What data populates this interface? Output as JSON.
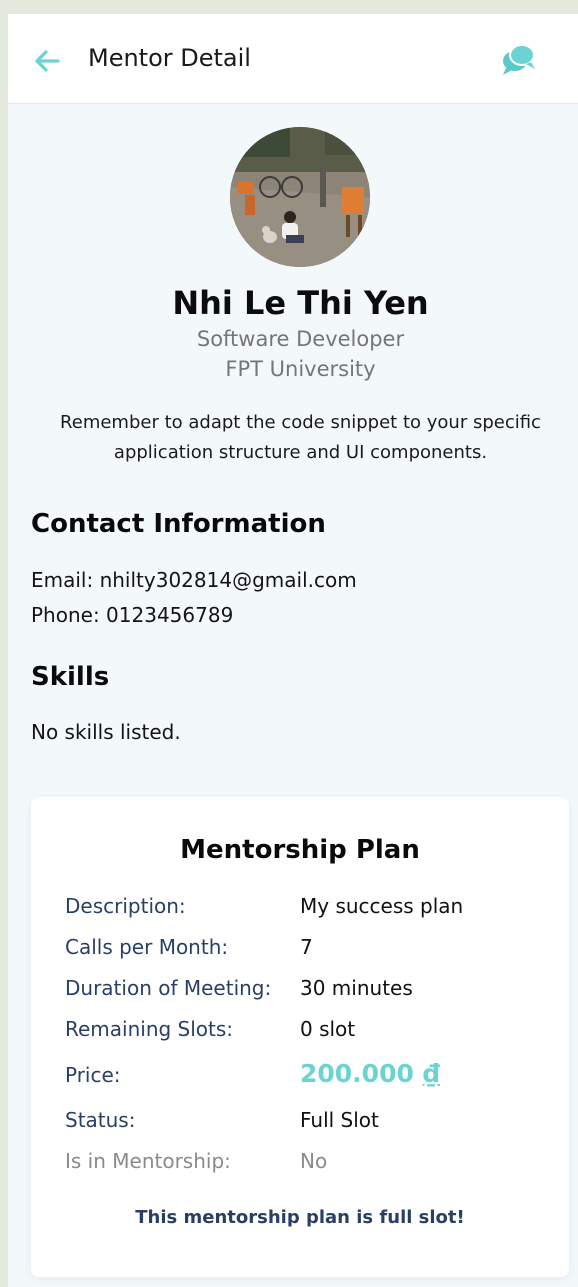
{
  "header": {
    "title": "Mentor Detail",
    "back_icon": "arrow-left-icon",
    "chat_icon": "chat-bubbles-icon",
    "accent_color": "#6cd3d3"
  },
  "mentor": {
    "name": "Nhi Le Thi Yen",
    "job_title": "Software Developer",
    "organization": "FPT University",
    "bio": "Remember to adapt the code snippet to your specific application structure and UI components."
  },
  "contact": {
    "section_title": "Contact Information",
    "email_line": "Email: nhilty302814@gmail.com",
    "phone_line": "Phone: 0123456789"
  },
  "skills": {
    "section_title": "Skills",
    "empty_text": "No skills listed."
  },
  "plan": {
    "title": "Mentorship Plan",
    "rows": [
      {
        "label": "Description:",
        "value": "My success plan"
      },
      {
        "label": "Calls per Month:",
        "value": "7"
      },
      {
        "label": "Duration of Meeting:",
        "value": "30 minutes"
      },
      {
        "label": "Remaining Slots:",
        "value": "0 slot"
      },
      {
        "label": "Price:",
        "value": "200.000",
        "currency": "₫"
      },
      {
        "label": "Status:",
        "value": "Full Slot"
      },
      {
        "label": "Is in Mentorship:",
        "value": "No"
      }
    ],
    "note": "This mentorship plan is full slot!"
  }
}
